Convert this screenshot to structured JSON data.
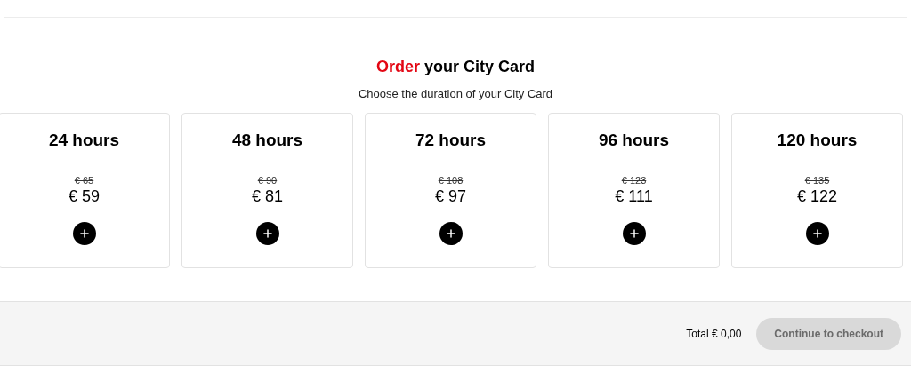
{
  "heading": {
    "highlight": "Order",
    "rest": "your City Card"
  },
  "subtitle": "Choose the duration of your City Card",
  "cards": [
    {
      "duration": "24 hours",
      "old_price": "€ 65",
      "price": "€ 59"
    },
    {
      "duration": "48 hours",
      "old_price": "€ 90",
      "price": "€ 81"
    },
    {
      "duration": "72 hours",
      "old_price": "€ 108",
      "price": "€ 97"
    },
    {
      "duration": "96 hours",
      "old_price": "€ 123",
      "price": "€ 111"
    },
    {
      "duration": "120 hours",
      "old_price": "€ 135",
      "price": "€ 122"
    }
  ],
  "footer": {
    "total": "Total € 0,00",
    "checkout_button": {
      "label": "Continue to checkout",
      "disabled": true
    }
  }
}
